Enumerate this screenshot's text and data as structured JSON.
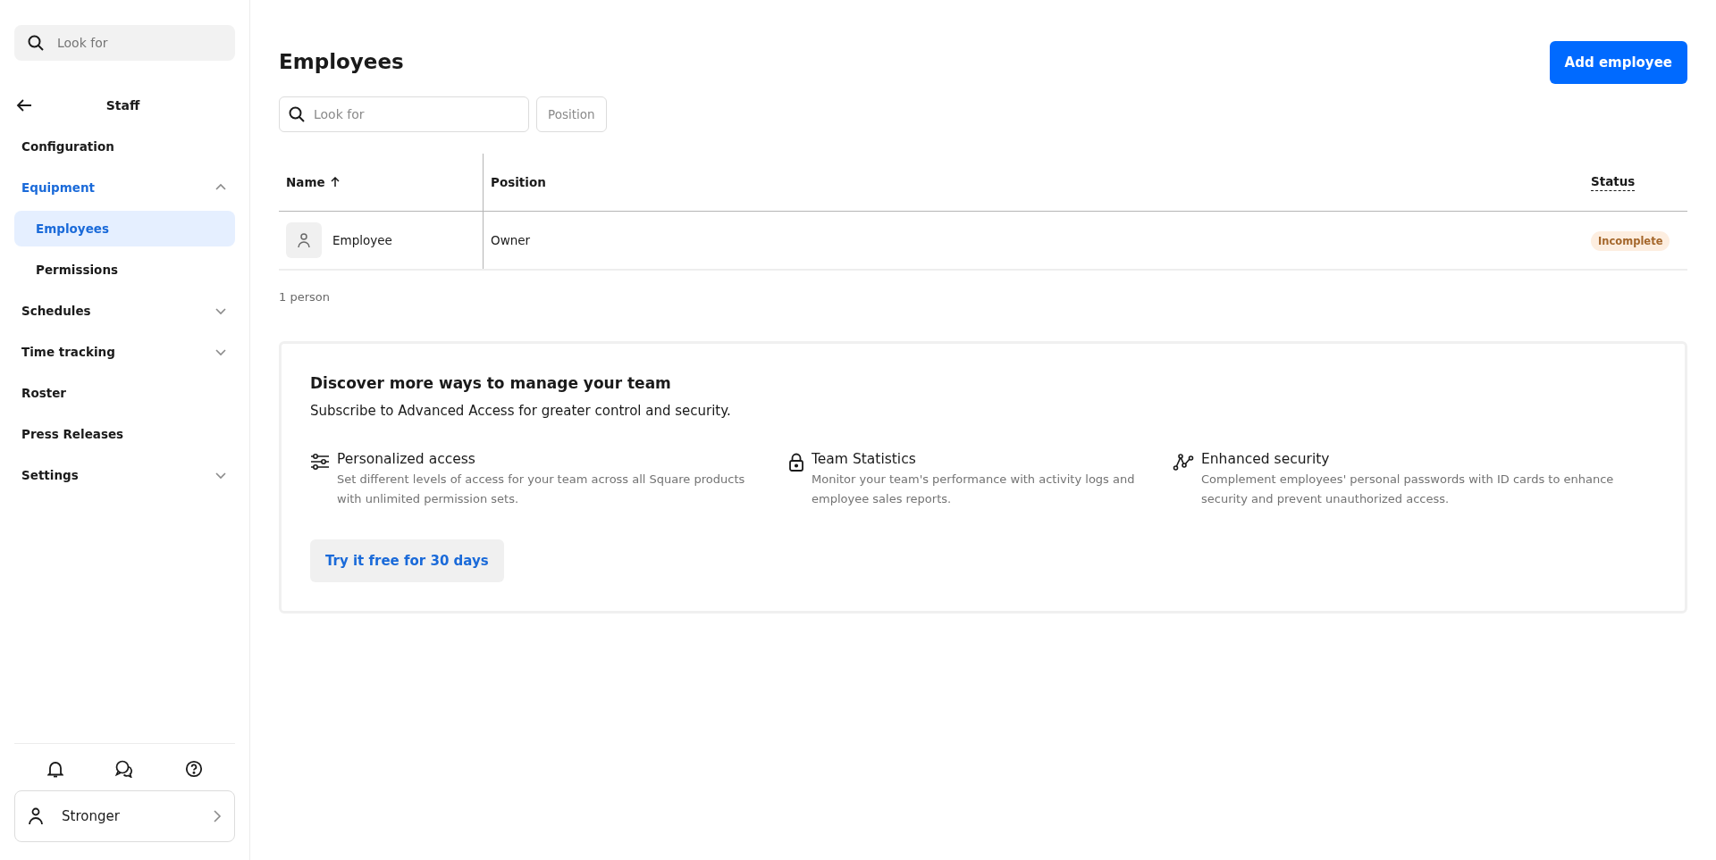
{
  "sidebar": {
    "search": {
      "placeholder": "Look for"
    },
    "section_title": "Staff",
    "items": [
      {
        "kind": "link",
        "label": "Configuration",
        "selected": false
      },
      {
        "kind": "group",
        "label": "Equipment",
        "selected": false,
        "expanded": true,
        "children": [
          {
            "label": "Employees",
            "selected": true
          },
          {
            "label": "Permissions",
            "selected": false
          }
        ]
      },
      {
        "kind": "group",
        "label": "Schedules",
        "selected": false,
        "expanded": false
      },
      {
        "kind": "group",
        "label": "Time tracking",
        "selected": false,
        "expanded": false
      },
      {
        "kind": "link",
        "label": "Roster",
        "selected": false
      },
      {
        "kind": "link",
        "label": "Press Releases",
        "selected": false
      },
      {
        "kind": "group",
        "label": "Settings",
        "selected": false,
        "expanded": false
      }
    ],
    "account": {
      "name": "Stronger"
    }
  },
  "page": {
    "title": "Employees",
    "primary_button": "Add employee",
    "search": {
      "placeholder": "Look for"
    },
    "filter": "Position",
    "table": {
      "columns": [
        {
          "label": "Name",
          "sorted_ascending": true
        },
        {
          "label": "Position"
        },
        {
          "label": "Status"
        }
      ],
      "rows": [
        {
          "name": "Employee",
          "position": "Owner",
          "status": "Incomplete"
        }
      ]
    },
    "count": "1 person",
    "promo": {
      "title": "Discover more ways to manage your team",
      "subtitle": "Subscribe to Advanced Access for greater control and security.",
      "features": [
        {
          "kind": "sliders",
          "title": "Personalized access",
          "text": "Set different levels of access for your team across all Square products with unlimited permission sets."
        },
        {
          "kind": "lock",
          "title": "Team Statistics",
          "text": "Monitor your team's performance with activity logs and employee sales reports."
        },
        {
          "kind": "path",
          "title": "Enhanced security",
          "text": "Complement employees' personal passwords with ID cards to enhance security and prevent unauthorized access."
        }
      ],
      "button": "Try it free for 30 days"
    }
  }
}
